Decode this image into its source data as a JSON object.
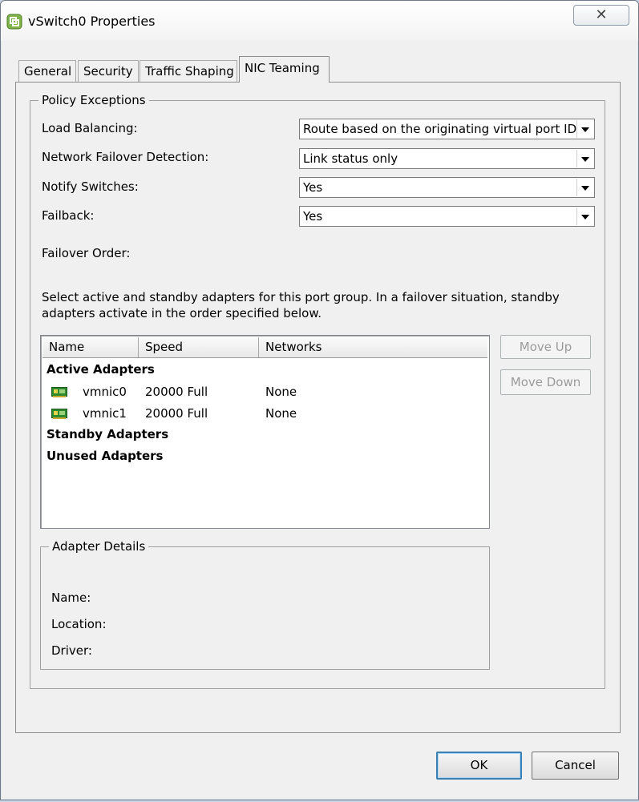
{
  "window": {
    "title": "vSwitch0 Properties",
    "close_symbol": "✕",
    "icon": "vsphere-app-icon"
  },
  "tabs": [
    {
      "label": "General"
    },
    {
      "label": "Security"
    },
    {
      "label": "Traffic Shaping"
    },
    {
      "label": "NIC Teaming",
      "active": true
    }
  ],
  "policy": {
    "legend": "Policy Exceptions",
    "load_balancing_label": "Load Balancing:",
    "load_balancing_value": "Route based on the originating virtual port ID",
    "failover_detection_label": "Network Failover Detection:",
    "failover_detection_value": "Link status only",
    "notify_label": "Notify Switches:",
    "notify_value": "Yes",
    "failback_label": "Failback:",
    "failback_value": "Yes",
    "failover_order_label": "Failover Order:",
    "instructions_line1": "Select active and standby adapters for this port group.  In a failover situation, standby",
    "instructions_line2": "adapters activate  in the order specified below."
  },
  "adapters": {
    "columns": [
      "Name",
      "Speed",
      "Networks"
    ],
    "active_group": "Active Adapters",
    "standby_group": "Standby Adapters",
    "unused_group": "Unused Adapters",
    "rows": [
      {
        "name": "vmnic0",
        "speed": "20000 Full",
        "networks": "None",
        "icon": "network-adapter-icon"
      },
      {
        "name": "vmnic1",
        "speed": "20000 Full",
        "networks": "None",
        "icon": "network-adapter-icon"
      }
    ],
    "move_up": "Move Up",
    "move_down": "Move Down"
  },
  "details": {
    "legend": "Adapter Details",
    "name_label": "Name:",
    "location_label": "Location:",
    "driver_label": "Driver:"
  },
  "footer": {
    "ok": "OK",
    "cancel": "Cancel"
  }
}
